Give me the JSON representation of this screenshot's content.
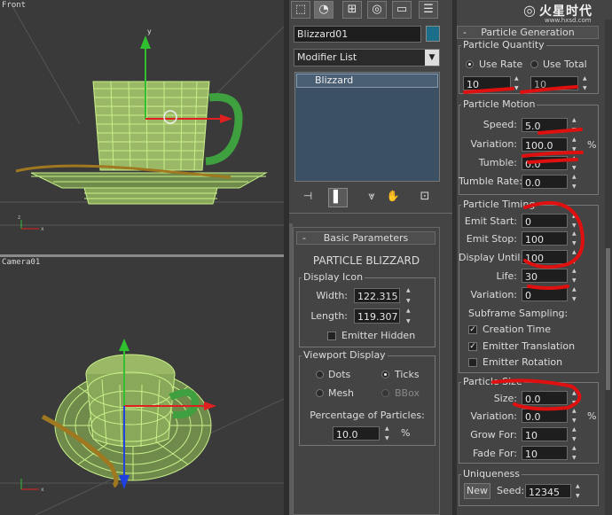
{
  "viewports": {
    "front": {
      "label": "Front"
    },
    "camera": {
      "label": "Camera01"
    },
    "axis_x": "x",
    "axis_y": "y",
    "axis_z": "z"
  },
  "toolbar": {
    "tabs": [
      {
        "icon": "create-icon",
        "glyph": "⬚"
      },
      {
        "icon": "modify-icon",
        "glyph": "◔"
      },
      {
        "icon": "hierarchy-icon",
        "glyph": "⊞"
      },
      {
        "icon": "motion-icon",
        "glyph": "◎"
      },
      {
        "icon": "display-icon",
        "glyph": "▭"
      },
      {
        "icon": "utilities-icon",
        "glyph": "☰"
      }
    ]
  },
  "object": {
    "name": "Blizzard01",
    "color": "#1a6e8a",
    "modifier_list": "Modifier List",
    "stack_items": [
      "Blizzard"
    ]
  },
  "stack_buttons": [
    {
      "icon": "pin-stack-icon",
      "glyph": "⊣"
    },
    {
      "icon": "show-end-result-icon",
      "glyph": "▌"
    },
    {
      "icon": "make-unique-icon",
      "glyph": "⩔"
    },
    {
      "icon": "remove-modifier-icon",
      "glyph": "✋"
    },
    {
      "icon": "configure-sets-icon",
      "glyph": "⊡"
    }
  ],
  "basic_params": {
    "header": "Basic Parameters",
    "minus": "-",
    "title": "PARTICLE BLIZZARD",
    "display_icon": {
      "group": "Display Icon",
      "width_label": "Width:",
      "width": "122.315",
      "length_label": "Length:",
      "length": "119.307",
      "hidden_label": "Emitter Hidden",
      "hidden": false
    },
    "viewport_display": {
      "group": "Viewport Display",
      "dots": "Dots",
      "ticks": "Ticks",
      "mesh": "Mesh",
      "bbox": "BBox",
      "selected": "Ticks",
      "pct_label": "Percentage of Particles:",
      "pct_value": "10.0",
      "pct_unit": "%"
    }
  },
  "particle_gen": {
    "header": "Particle Generation",
    "minus": "-",
    "quantity": {
      "group": "Particle Quantity",
      "use_rate": "Use Rate",
      "use_total": "Use Total",
      "selected": "Use Rate",
      "rate_value": "10",
      "total_value": "10"
    },
    "motion": {
      "group": "Particle Motion",
      "speed_label": "Speed:",
      "speed": "5.0",
      "variation_label": "Variation:",
      "variation": "100.0",
      "variation_unit": "%",
      "tumble_label": "Tumble:",
      "tumble": "0.0",
      "tumble_rate_label": "Tumble Rate:",
      "tumble_rate": "0.0"
    },
    "timing": {
      "group": "Particle Timing",
      "emit_start_label": "Emit Start:",
      "emit_start": "0",
      "emit_stop_label": "Emit Stop:",
      "emit_stop": "100",
      "display_until_label": "Display Until:",
      "display_until": "100",
      "life_label": "Life:",
      "life": "30",
      "variation_label": "Variation:",
      "variation": "0",
      "subframe_label": "Subframe Sampling:",
      "creation_time": "Creation Time",
      "creation_time_checked": true,
      "emitter_translation": "Emitter Translation",
      "emitter_translation_checked": true,
      "emitter_rotation": "Emitter Rotation",
      "emitter_rotation_checked": false
    },
    "size": {
      "group": "Particle Size",
      "size_label": "Size:",
      "size": "0.0",
      "variation_label": "Variation:",
      "variation": "0.0",
      "variation_unit": "%",
      "grow_for_label": "Grow For:",
      "grow_for": "10",
      "fade_for_label": "Fade For:",
      "fade_for": "10"
    },
    "uniqueness": {
      "group": "Uniqueness",
      "new_label": "New",
      "seed_label": "Seed:",
      "seed": "12345"
    }
  },
  "watermark": {
    "brand": "火星时代",
    "url": "www.hxsd.com"
  },
  "colors": {
    "annotation": "#e01010",
    "wireframe": "#c8f08a",
    "spoon": "#a07820",
    "handle": "#3fa040",
    "gizmo_x": "#e02020",
    "gizmo_y": "#30c030",
    "gizmo_z": "#2040e0"
  }
}
